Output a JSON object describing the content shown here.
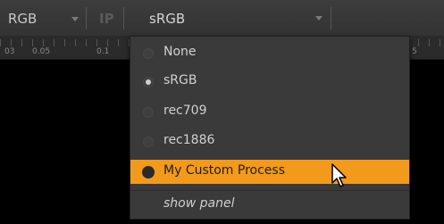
{
  "toolbar": {
    "channel_value": "RGB",
    "ip_label": "IP",
    "colorspace_value": "sRGB"
  },
  "ruler": {
    "ticks": [
      "03",
      "0.05",
      "0.1",
      "5"
    ]
  },
  "menu": {
    "items": [
      {
        "label": "None",
        "checked": false
      },
      {
        "label": "sRGB",
        "checked": true
      },
      {
        "label": "rec709",
        "checked": false
      },
      {
        "label": "rec1886",
        "checked": false
      },
      {
        "label": "My Custom Process",
        "checked": false,
        "highlighted": true
      }
    ],
    "show_panel_label": "show panel"
  },
  "colors": {
    "highlight": "#f29a1c",
    "menu_bg": "#3a3a3a",
    "toolbar_bg": "#383838"
  },
  "icons": [
    "chevron-down-icon",
    "radio-icon",
    "mouse-pointer-icon"
  ]
}
